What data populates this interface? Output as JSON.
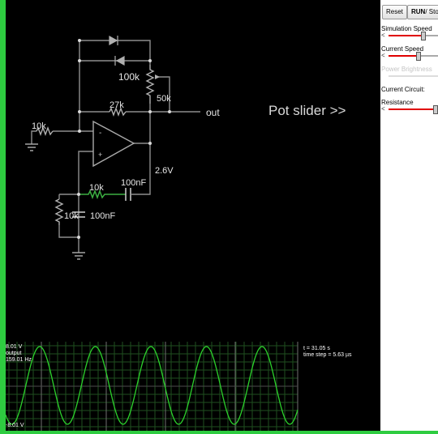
{
  "toolbar": {
    "reset_label": "Reset",
    "run_label": "RUN",
    "stop_label": "/ Stop"
  },
  "side_panel": {
    "simulation_speed_label": "Simulation Speed",
    "simulation_speed_value": 0.7,
    "current_speed_label": "Current Speed",
    "current_speed_value": 0.6,
    "power_brightness_label": "Power Brightness",
    "current_circuit_label": "Current Circuit:",
    "resistance_label": "Resistance",
    "resistance_value": 0.95
  },
  "circuit": {
    "labels": {
      "r_input": "10k",
      "r_pot_top": "100k",
      "r_pot_bottom": "50k",
      "r_feedback": "27k",
      "output": "out",
      "voltage": "2.6V",
      "r_series": "10k",
      "c_series": "100nF",
      "r_shunt": "10k",
      "c_shunt": "100nF"
    },
    "pot_hint": "Pot slider >>"
  },
  "scope": {
    "max_voltage": "8.01 V",
    "min_voltage": "-8.01 V",
    "signal_name": "output",
    "frequency": "159.01 Hz",
    "time": "t = 31.05 s",
    "time_step": "time step = 5.63 µs"
  },
  "colors": {
    "frame_green": "#2ecc40",
    "wire_gray": "#8e8e8e",
    "active_green": "#3cb043",
    "slider_red": "#e00000",
    "trace_green": "#2bd12b"
  }
}
